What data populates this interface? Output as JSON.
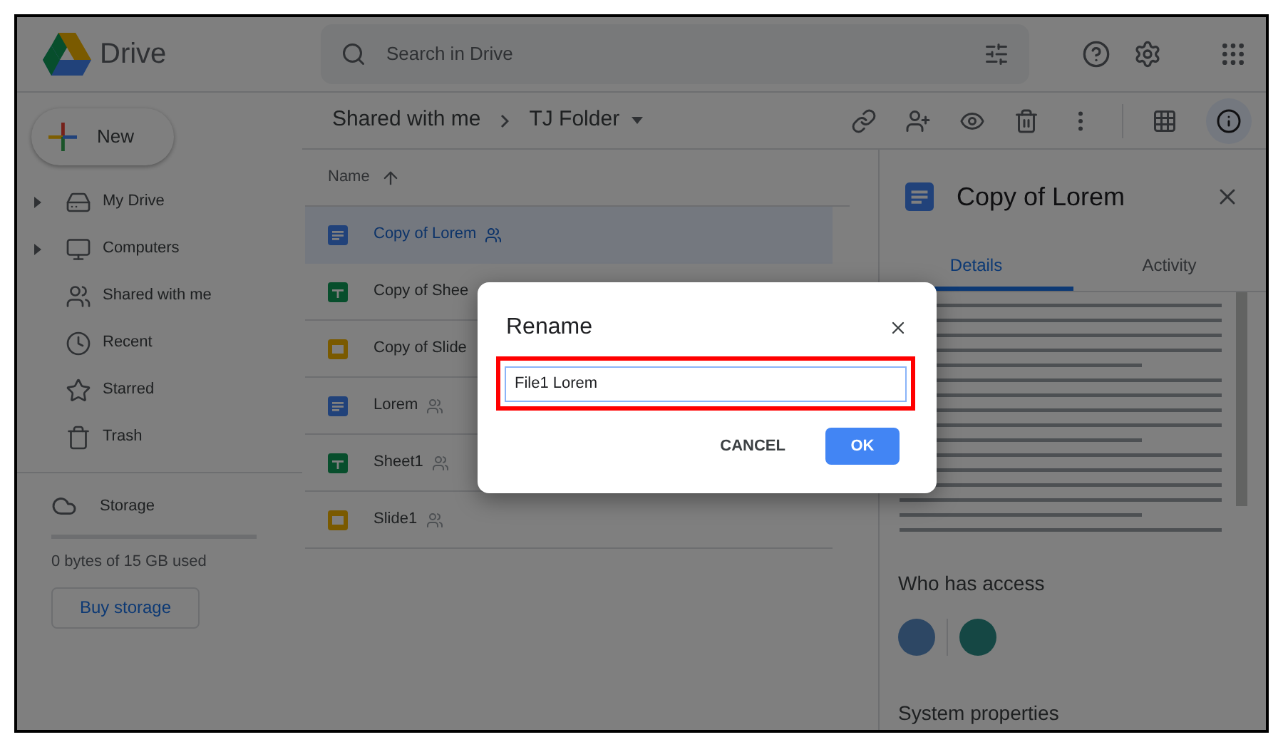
{
  "header": {
    "app_name": "Drive",
    "search": {
      "placeholder": "Search in Drive"
    }
  },
  "sidebar": {
    "new_button": "New",
    "items": [
      {
        "label": "My Drive",
        "kind": "drive",
        "expandable": true
      },
      {
        "label": "Computers",
        "kind": "computers",
        "expandable": true
      },
      {
        "label": "Shared with me",
        "kind": "shared",
        "expandable": false
      },
      {
        "label": "Recent",
        "kind": "recent",
        "expandable": false
      },
      {
        "label": "Starred",
        "kind": "starred",
        "expandable": false
      },
      {
        "label": "Trash",
        "kind": "trash",
        "expandable": false
      }
    ],
    "storage": {
      "label": "Storage",
      "level": 0,
      "usage": "0 bytes of 15 GB used",
      "button": "Buy storage"
    }
  },
  "breadcrumb": [
    "Shared with me",
    "TJ Folder"
  ],
  "toolbar": {
    "info_selected": true
  },
  "file_list": {
    "column": "Name",
    "files": [
      {
        "name": "Copy of Lorem",
        "kind": "doc",
        "shared": true,
        "selected": true
      },
      {
        "name": "Copy of Shee",
        "kind": "sheet",
        "shared": false,
        "selected": false
      },
      {
        "name": "Copy of Slide",
        "kind": "slide",
        "shared": false,
        "selected": false
      },
      {
        "name": "Lorem",
        "kind": "doc",
        "shared": true,
        "selected": false
      },
      {
        "name": "Sheet1",
        "kind": "sheet",
        "shared": true,
        "selected": false
      },
      {
        "name": "Slide1",
        "kind": "slide",
        "shared": true,
        "selected": false
      }
    ]
  },
  "details_panel": {
    "title": "Copy of Lorem",
    "tabs": [
      {
        "label": "Details",
        "selected": true
      },
      {
        "label": "Activity",
        "selected": false
      }
    ],
    "who_has_access": "Who has access",
    "system_properties": "System properties"
  },
  "dialog": {
    "title": "Rename",
    "value": "File1 Lorem",
    "buttons": [
      {
        "label": "CANCEL",
        "kind": "text"
      },
      {
        "label": "OK",
        "kind": "primary"
      }
    ]
  }
}
